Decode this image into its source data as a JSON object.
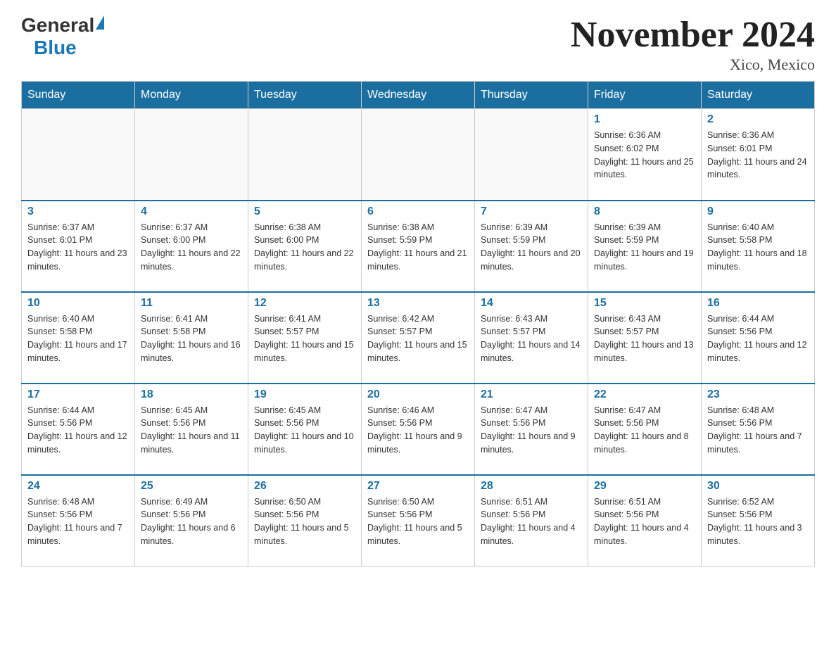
{
  "header": {
    "logo_general": "General",
    "logo_blue": "Blue",
    "title": "November 2024",
    "subtitle": "Xico, Mexico"
  },
  "days_of_week": [
    "Sunday",
    "Monday",
    "Tuesday",
    "Wednesday",
    "Thursday",
    "Friday",
    "Saturday"
  ],
  "weeks": [
    [
      {
        "day": "",
        "sunrise": "",
        "sunset": "",
        "daylight": ""
      },
      {
        "day": "",
        "sunrise": "",
        "sunset": "",
        "daylight": ""
      },
      {
        "day": "",
        "sunrise": "",
        "sunset": "",
        "daylight": ""
      },
      {
        "day": "",
        "sunrise": "",
        "sunset": "",
        "daylight": ""
      },
      {
        "day": "",
        "sunrise": "",
        "sunset": "",
        "daylight": ""
      },
      {
        "day": "1",
        "sunrise": "Sunrise: 6:36 AM",
        "sunset": "Sunset: 6:02 PM",
        "daylight": "Daylight: 11 hours and 25 minutes."
      },
      {
        "day": "2",
        "sunrise": "Sunrise: 6:36 AM",
        "sunset": "Sunset: 6:01 PM",
        "daylight": "Daylight: 11 hours and 24 minutes."
      }
    ],
    [
      {
        "day": "3",
        "sunrise": "Sunrise: 6:37 AM",
        "sunset": "Sunset: 6:01 PM",
        "daylight": "Daylight: 11 hours and 23 minutes."
      },
      {
        "day": "4",
        "sunrise": "Sunrise: 6:37 AM",
        "sunset": "Sunset: 6:00 PM",
        "daylight": "Daylight: 11 hours and 22 minutes."
      },
      {
        "day": "5",
        "sunrise": "Sunrise: 6:38 AM",
        "sunset": "Sunset: 6:00 PM",
        "daylight": "Daylight: 11 hours and 22 minutes."
      },
      {
        "day": "6",
        "sunrise": "Sunrise: 6:38 AM",
        "sunset": "Sunset: 5:59 PM",
        "daylight": "Daylight: 11 hours and 21 minutes."
      },
      {
        "day": "7",
        "sunrise": "Sunrise: 6:39 AM",
        "sunset": "Sunset: 5:59 PM",
        "daylight": "Daylight: 11 hours and 20 minutes."
      },
      {
        "day": "8",
        "sunrise": "Sunrise: 6:39 AM",
        "sunset": "Sunset: 5:59 PM",
        "daylight": "Daylight: 11 hours and 19 minutes."
      },
      {
        "day": "9",
        "sunrise": "Sunrise: 6:40 AM",
        "sunset": "Sunset: 5:58 PM",
        "daylight": "Daylight: 11 hours and 18 minutes."
      }
    ],
    [
      {
        "day": "10",
        "sunrise": "Sunrise: 6:40 AM",
        "sunset": "Sunset: 5:58 PM",
        "daylight": "Daylight: 11 hours and 17 minutes."
      },
      {
        "day": "11",
        "sunrise": "Sunrise: 6:41 AM",
        "sunset": "Sunset: 5:58 PM",
        "daylight": "Daylight: 11 hours and 16 minutes."
      },
      {
        "day": "12",
        "sunrise": "Sunrise: 6:41 AM",
        "sunset": "Sunset: 5:57 PM",
        "daylight": "Daylight: 11 hours and 15 minutes."
      },
      {
        "day": "13",
        "sunrise": "Sunrise: 6:42 AM",
        "sunset": "Sunset: 5:57 PM",
        "daylight": "Daylight: 11 hours and 15 minutes."
      },
      {
        "day": "14",
        "sunrise": "Sunrise: 6:43 AM",
        "sunset": "Sunset: 5:57 PM",
        "daylight": "Daylight: 11 hours and 14 minutes."
      },
      {
        "day": "15",
        "sunrise": "Sunrise: 6:43 AM",
        "sunset": "Sunset: 5:57 PM",
        "daylight": "Daylight: 11 hours and 13 minutes."
      },
      {
        "day": "16",
        "sunrise": "Sunrise: 6:44 AM",
        "sunset": "Sunset: 5:56 PM",
        "daylight": "Daylight: 11 hours and 12 minutes."
      }
    ],
    [
      {
        "day": "17",
        "sunrise": "Sunrise: 6:44 AM",
        "sunset": "Sunset: 5:56 PM",
        "daylight": "Daylight: 11 hours and 12 minutes."
      },
      {
        "day": "18",
        "sunrise": "Sunrise: 6:45 AM",
        "sunset": "Sunset: 5:56 PM",
        "daylight": "Daylight: 11 hours and 11 minutes."
      },
      {
        "day": "19",
        "sunrise": "Sunrise: 6:45 AM",
        "sunset": "Sunset: 5:56 PM",
        "daylight": "Daylight: 11 hours and 10 minutes."
      },
      {
        "day": "20",
        "sunrise": "Sunrise: 6:46 AM",
        "sunset": "Sunset: 5:56 PM",
        "daylight": "Daylight: 11 hours and 9 minutes."
      },
      {
        "day": "21",
        "sunrise": "Sunrise: 6:47 AM",
        "sunset": "Sunset: 5:56 PM",
        "daylight": "Daylight: 11 hours and 9 minutes."
      },
      {
        "day": "22",
        "sunrise": "Sunrise: 6:47 AM",
        "sunset": "Sunset: 5:56 PM",
        "daylight": "Daylight: 11 hours and 8 minutes."
      },
      {
        "day": "23",
        "sunrise": "Sunrise: 6:48 AM",
        "sunset": "Sunset: 5:56 PM",
        "daylight": "Daylight: 11 hours and 7 minutes."
      }
    ],
    [
      {
        "day": "24",
        "sunrise": "Sunrise: 6:48 AM",
        "sunset": "Sunset: 5:56 PM",
        "daylight": "Daylight: 11 hours and 7 minutes."
      },
      {
        "day": "25",
        "sunrise": "Sunrise: 6:49 AM",
        "sunset": "Sunset: 5:56 PM",
        "daylight": "Daylight: 11 hours and 6 minutes."
      },
      {
        "day": "26",
        "sunrise": "Sunrise: 6:50 AM",
        "sunset": "Sunset: 5:56 PM",
        "daylight": "Daylight: 11 hours and 5 minutes."
      },
      {
        "day": "27",
        "sunrise": "Sunrise: 6:50 AM",
        "sunset": "Sunset: 5:56 PM",
        "daylight": "Daylight: 11 hours and 5 minutes."
      },
      {
        "day": "28",
        "sunrise": "Sunrise: 6:51 AM",
        "sunset": "Sunset: 5:56 PM",
        "daylight": "Daylight: 11 hours and 4 minutes."
      },
      {
        "day": "29",
        "sunrise": "Sunrise: 6:51 AM",
        "sunset": "Sunset: 5:56 PM",
        "daylight": "Daylight: 11 hours and 4 minutes."
      },
      {
        "day": "30",
        "sunrise": "Sunrise: 6:52 AM",
        "sunset": "Sunset: 5:56 PM",
        "daylight": "Daylight: 11 hours and 3 minutes."
      }
    ]
  ]
}
